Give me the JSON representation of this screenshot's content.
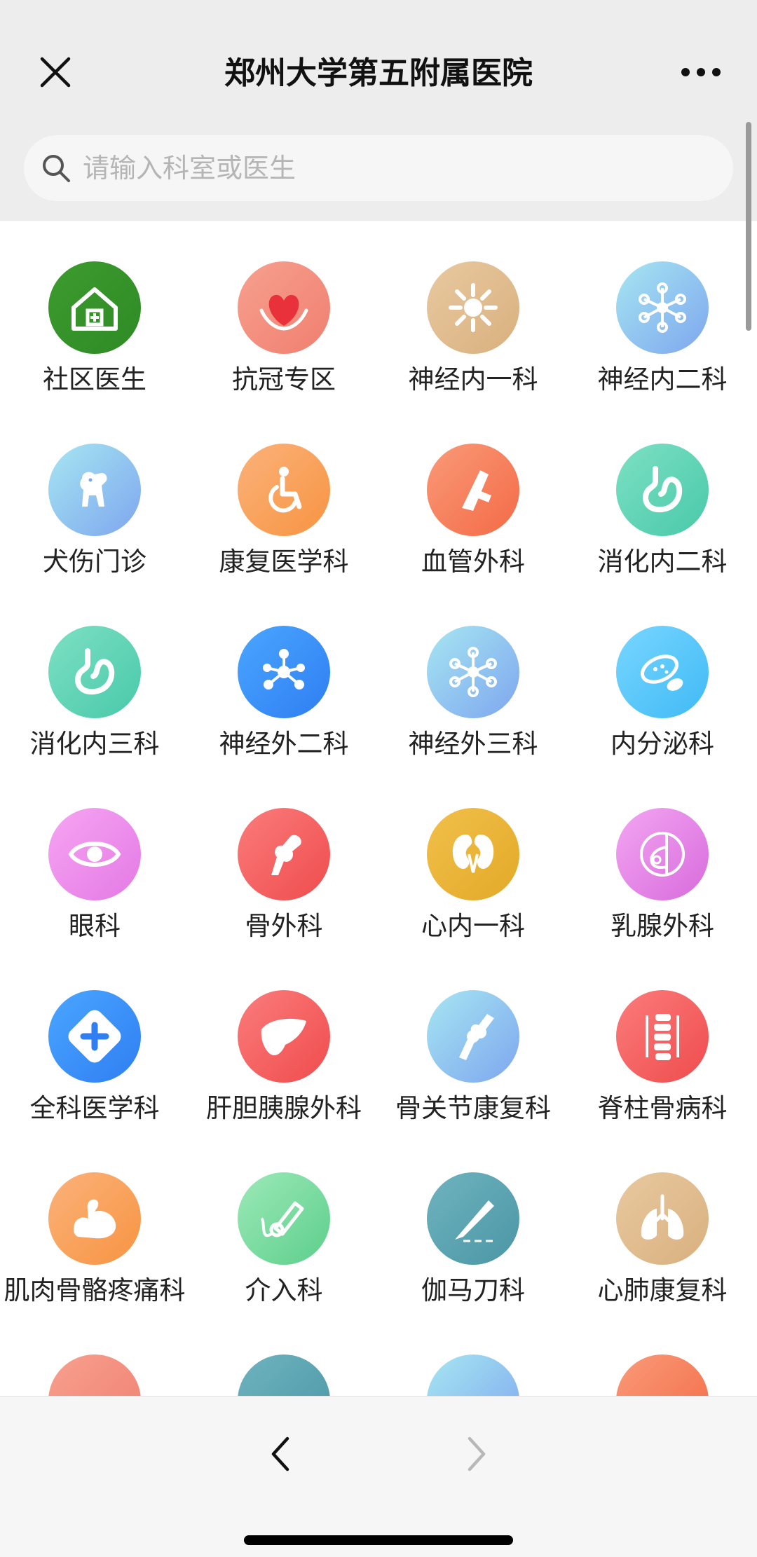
{
  "header": {
    "title": "郑州大学第五附属医院",
    "close_icon": "close-icon",
    "more_icon": "more-icon"
  },
  "search": {
    "placeholder": "请输入科室或医生",
    "value": ""
  },
  "departments": [
    {
      "label": "社区医生",
      "icon": "community-house-icon",
      "color1": "#3c9b2e",
      "color2": "#2f8a25"
    },
    {
      "label": "抗冠专区",
      "icon": "heart-hands-icon",
      "color1": "#f7a08f",
      "color2": "#f07f6f"
    },
    {
      "label": "神经内一科",
      "icon": "neuron-icon",
      "color1": "#e8c9a0",
      "color2": "#d9b07e"
    },
    {
      "label": "神经内二科",
      "icon": "neuron-network-icon",
      "color1": "#a6e6f2",
      "color2": "#7ea6ee"
    },
    {
      "label": "犬伤门诊",
      "icon": "dog-icon",
      "color1": "#a6e6f2",
      "color2": "#7ea6ee"
    },
    {
      "label": "康复医学科",
      "icon": "wheelchair-icon",
      "color1": "#fbb27a",
      "color2": "#f79442"
    },
    {
      "label": "血管外科",
      "icon": "blood-vessel-icon",
      "color1": "#f99a78",
      "color2": "#f46a46"
    },
    {
      "label": "消化内二科",
      "icon": "stomach-icon",
      "color1": "#7ee0c4",
      "color2": "#48c9a9"
    },
    {
      "label": "消化内三科",
      "icon": "stomach-icon",
      "color1": "#7ee0c4",
      "color2": "#48c9a9"
    },
    {
      "label": "神经外二科",
      "icon": "molecule-icon",
      "color1": "#4aa6ff",
      "color2": "#2f7ef2"
    },
    {
      "label": "神经外三科",
      "icon": "neuron-network-icon",
      "color1": "#a6e6f2",
      "color2": "#7ea6ee"
    },
    {
      "label": "内分泌科",
      "icon": "bacteria-icon",
      "color1": "#79d6ff",
      "color2": "#3fbaf5"
    },
    {
      "label": "眼科",
      "icon": "eye-icon",
      "color1": "#f6a5f2",
      "color2": "#e479e5"
    },
    {
      "label": "骨外科",
      "icon": "bone-joint-icon",
      "color1": "#fb7c7c",
      "color2": "#ef4c4c"
    },
    {
      "label": "心内一科",
      "icon": "kidney-icon",
      "color1": "#f1c04a",
      "color2": "#e3a928"
    },
    {
      "label": "乳腺外科",
      "icon": "breast-icon",
      "color1": "#f3a6f2",
      "color2": "#d86bdc"
    },
    {
      "label": "全科医学科",
      "icon": "medical-cross-icon",
      "color1": "#4aa6ff",
      "color2": "#2f7ef2"
    },
    {
      "label": "肝胆胰腺外科",
      "icon": "liver-icon",
      "color1": "#fb7c7c",
      "color2": "#ef4c4c"
    },
    {
      "label": "骨关节康复科",
      "icon": "knee-joint-icon",
      "color1": "#a6e6f2",
      "color2": "#7ea6ee"
    },
    {
      "label": "脊柱骨病科",
      "icon": "spine-icon",
      "color1": "#fb7c7c",
      "color2": "#ef4c4c"
    },
    {
      "label": "肌肉骨骼疼痛科",
      "icon": "muscle-arm-icon",
      "color1": "#fbb27a",
      "color2": "#f79442"
    },
    {
      "label": "介入科",
      "icon": "catheter-icon",
      "color1": "#9de9b8",
      "color2": "#5ccf8b"
    },
    {
      "label": "伽马刀科",
      "icon": "scalpel-icon",
      "color1": "#6fb3bf",
      "color2": "#4b96a5"
    },
    {
      "label": "心肺康复科",
      "icon": "lungs-icon",
      "color1": "#e8c9a0",
      "color2": "#d9b07e"
    },
    {
      "label": "",
      "icon": "partial-icon",
      "color1": "#f7a08f",
      "color2": "#f07f6f"
    },
    {
      "label": "",
      "icon": "partial-icon",
      "color1": "#6fb3bf",
      "color2": "#4b96a5"
    },
    {
      "label": "",
      "icon": "partial-icon",
      "color1": "#a6e6f2",
      "color2": "#7ea6ee"
    },
    {
      "label": "",
      "icon": "partial-icon",
      "color1": "#f99a78",
      "color2": "#f46a46"
    }
  ],
  "bottom_nav": {
    "back_icon": "chevron-left-icon",
    "forward_icon": "chevron-right-icon",
    "forward_enabled": false
  }
}
